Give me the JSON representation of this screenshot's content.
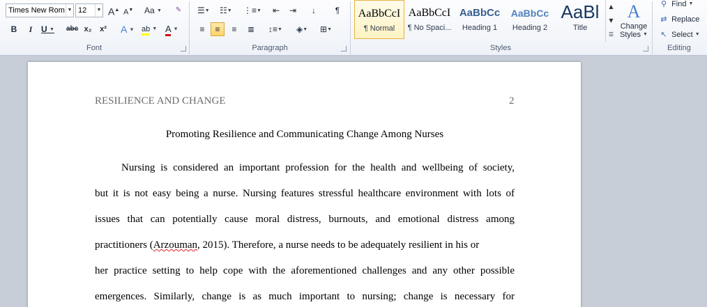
{
  "ribbon": {
    "font": {
      "label": "Font",
      "family": "Times New Rom",
      "size": "12",
      "grow": "A",
      "shrink": "A",
      "change_case": "Aa",
      "bold": "B",
      "italic": "I",
      "underline": "U",
      "strikethrough": "abc",
      "subscript": "x₂",
      "superscript": "x²",
      "text_effects": "A",
      "highlight": "ab",
      "font_color": "A"
    },
    "paragraph": {
      "label": "Paragraph",
      "pilcrow": "¶"
    },
    "styles": {
      "label": "Styles",
      "tiles": [
        {
          "sample": "AaBbCcI",
          "name": "¶ Normal"
        },
        {
          "sample": "AaBbCcI",
          "name": "¶ No Spaci..."
        },
        {
          "sample": "AaBbCc",
          "name": "Heading 1"
        },
        {
          "sample": "AaBbCc",
          "name": "Heading 2"
        },
        {
          "sample": "AaBl",
          "name": "Title"
        }
      ],
      "change_styles_line1": "Change",
      "change_styles_line2": "Styles",
      "heading_color": "#365f91"
    },
    "editing": {
      "label": "Editing",
      "find": "Find",
      "replace": "Replace",
      "select": "Select"
    }
  },
  "document": {
    "header_left": "RESILIENCE AND CHANGE",
    "page_number": "2",
    "title": "Promoting Resilience and Communicating Change Among Nurses",
    "lines": [
      "Nursing is considered an important profession for the health and wellbeing of society,",
      "but it is not easy being a nurse. Nursing features stressful healthcare environment with lots of",
      "issues that can potentially cause moral distress, burnouts, and emotional distress among",
      "practitioners (",
      "Arzouman",
      ", 2015). Therefore, a nurse needs to be adequately resilient in his or",
      "her practice setting to help cope with the aforementioned challenges and any other possible",
      "emergences. Similarly, change is as much important to nursing; change is necessary for"
    ]
  }
}
